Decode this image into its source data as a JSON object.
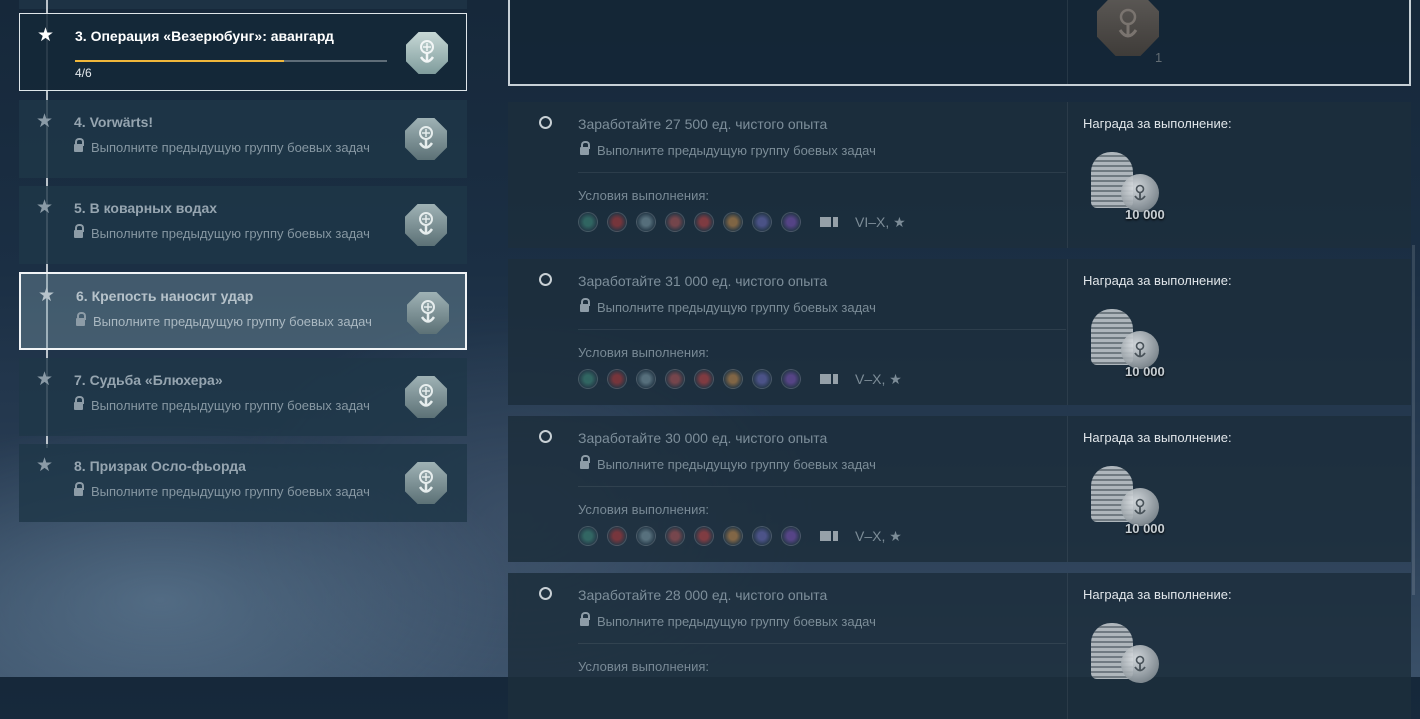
{
  "operations": [
    {
      "title": "3. Операция «Везерюбунг»: авангард",
      "state": "active",
      "progress_text": "4/6",
      "progress_fraction": 0.67
    },
    {
      "title": "4. Vorwärts!",
      "state": "locked",
      "lock_text": "Выполните предыдущую группу боевых задач"
    },
    {
      "title": "5. В коварных водах",
      "state": "locked",
      "lock_text": "Выполните предыдущую группу боевых задач"
    },
    {
      "title": "6. Крепость наносит удар",
      "state": "selected",
      "lock_text": "Выполните предыдущую группу боевых задач"
    },
    {
      "title": "7. Судьба «Блюхера»",
      "state": "locked",
      "lock_text": "Выполните предыдущую группу боевых задач"
    },
    {
      "title": "8. Призрак Осло-фьорда",
      "state": "locked",
      "lock_text": "Выполните предыдущую группу боевых задач"
    }
  ],
  "top_reward": {
    "count": "1",
    "icon": "anchor-medal-icon"
  },
  "tasks": [
    {
      "title": "Заработайте 27 500 ед. чистого опыта",
      "lock_text": "Выполните предыдущую группу боевых задач",
      "conditions_label": "Условия выполнения:",
      "tiers": "VI–X, ★",
      "reward_label": "Награда за выполнение:",
      "reward_amount": "10 000"
    },
    {
      "title": "Заработайте 31 000 ед. чистого опыта",
      "lock_text": "Выполните предыдущую группу боевых задач",
      "conditions_label": "Условия выполнения:",
      "tiers": "V–X, ★",
      "reward_label": "Награда за выполнение:",
      "reward_amount": "10 000"
    },
    {
      "title": "Заработайте 30 000 ед. чистого опыта",
      "lock_text": "Выполните предыдущую группу боевых задач",
      "conditions_label": "Условия выполнения:",
      "tiers": "V–X, ★",
      "reward_label": "Награда за выполнение:",
      "reward_amount": "10 000"
    },
    {
      "title": "Заработайте 28 000 ед. чистого опыта",
      "lock_text": "Выполните предыдущую группу боевых задач",
      "conditions_label": "Условия выполнения:",
      "tiers": "",
      "reward_label": "Награда за выполнение:",
      "reward_amount": ""
    }
  ],
  "nation_icons": [
    {
      "name": "nation-usa-icon",
      "color": "#3f8a7a"
    },
    {
      "name": "nation-japan-icon",
      "color": "#b23a3a"
    },
    {
      "name": "nation-germany-icon",
      "color": "#7d9aa5"
    },
    {
      "name": "nation-ussr-icon",
      "color": "#b05555"
    },
    {
      "name": "nation-china-icon",
      "color": "#c04444"
    },
    {
      "name": "nation-uk-icon",
      "color": "#c28a4a"
    },
    {
      "name": "nation-france-icon",
      "color": "#6a6ab8"
    },
    {
      "name": "nation-pan-asia-icon",
      "color": "#7b52b5"
    }
  ],
  "accent_color": "#f0b73b"
}
